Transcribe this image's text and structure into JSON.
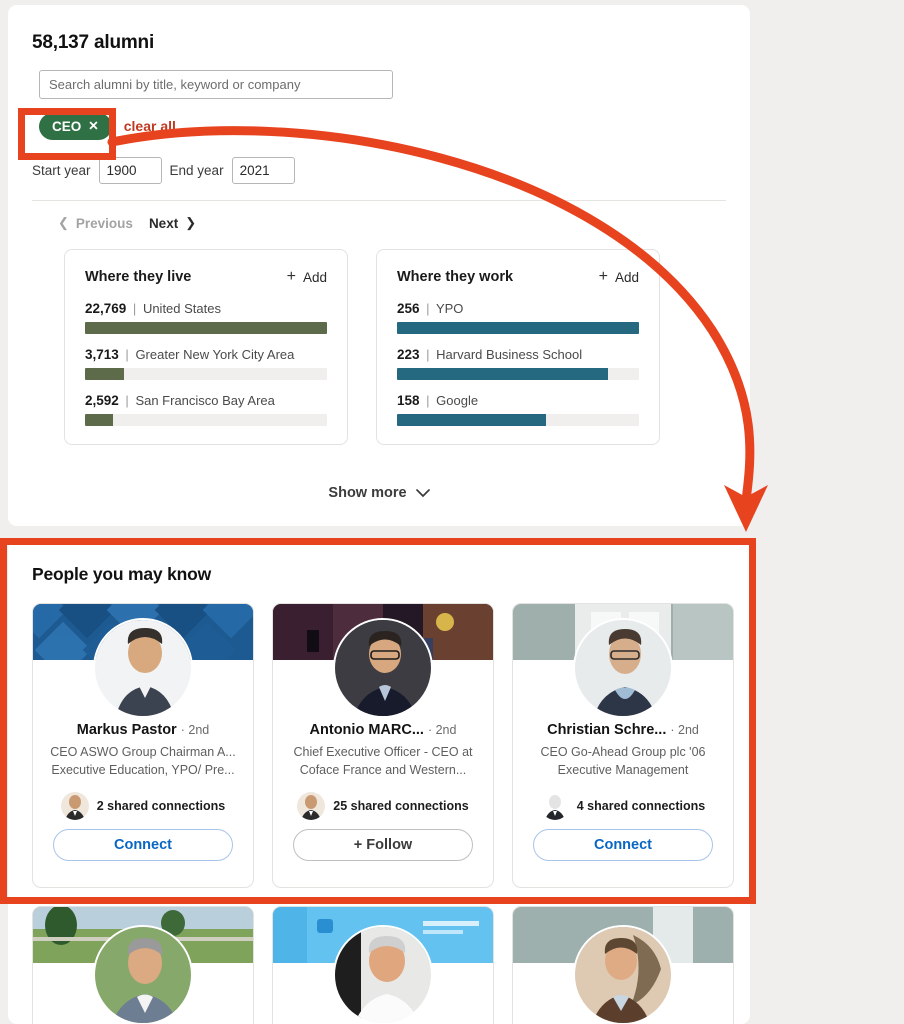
{
  "alumni": {
    "count_label": "58,137 alumni",
    "search": {
      "placeholder": "Search alumni by title, keyword or company",
      "value": ""
    },
    "filter_pill": {
      "label": "CEO",
      "remove_icon": "✕"
    },
    "clear_all_label": "clear all",
    "years": {
      "start_label": "Start year",
      "start_value": "1900",
      "end_label": "End year",
      "end_value": "2021"
    },
    "pager": {
      "previous_label": "Previous",
      "next_label": "Next",
      "prev_icon": "❮",
      "next_icon": "❯"
    },
    "show_more_label": "Show more",
    "show_more_icon": "⌄"
  },
  "chart_data": [
    {
      "type": "bar",
      "title": "Where they live",
      "add_label": "Add",
      "add_icon": "+",
      "orientation": "horizontal",
      "color": "#5e6b4a",
      "track_color": "#f0efed",
      "max": 22769,
      "categories": [
        "United States",
        "Greater New York City Area",
        "San Francisco Bay Area"
      ],
      "values": [
        22769,
        3713,
        2592
      ],
      "value_labels": [
        "22,769",
        "3,713",
        "2,592"
      ],
      "separator": "|",
      "xlabel": "",
      "ylabel": "",
      "grid": false,
      "legend": "none"
    },
    {
      "type": "bar",
      "title": "Where they work",
      "add_label": "Add",
      "add_icon": "+",
      "orientation": "horizontal",
      "color": "#24697f",
      "track_color": "#f0efed",
      "max": 256,
      "categories": [
        "YPO",
        "Harvard Business School",
        "Google"
      ],
      "values": [
        256,
        223,
        158
      ],
      "value_labels": [
        "256",
        "223",
        "158"
      ],
      "separator": "|",
      "xlabel": "",
      "ylabel": "",
      "grid": false,
      "legend": "none"
    }
  ],
  "people": {
    "title": "People you may know",
    "cards": [
      {
        "name": "Markus Pastor",
        "degree": "· 2nd",
        "headline": "CEO ASWO Group Chairman A... Executive Education, YPO/ Pre...",
        "shared_label": "2 shared connections",
        "action": "Connect",
        "action_type": "connect",
        "banner_style": "blue-diamond"
      },
      {
        "name": "Antonio MARC...",
        "degree": "· 2nd",
        "headline": "Chief Executive Officer - CEO at Coface France and Western...",
        "shared_label": "25 shared connections",
        "action": "+ Follow",
        "action_type": "follow",
        "banner_style": "stage-dark"
      },
      {
        "name": "Christian Schre...",
        "degree": "· 2nd",
        "headline": "CEO Go-Ahead Group plc '06 Executive Management",
        "shared_label": "4 shared connections",
        "action": "Connect",
        "action_type": "connect",
        "banner_style": "grey-office"
      }
    ],
    "cards_row2": [
      {
        "banner_style": "field-green"
      },
      {
        "banner_style": "light-blue"
      },
      {
        "banner_style": "grey-globe"
      }
    ]
  },
  "annotations": {
    "highlight_color": "#e8431f",
    "pill_box": "CEO filter pill highlight",
    "people_box": "People you may know section highlight",
    "arrow": "curved arrow from CEO pill to People you may know section"
  }
}
